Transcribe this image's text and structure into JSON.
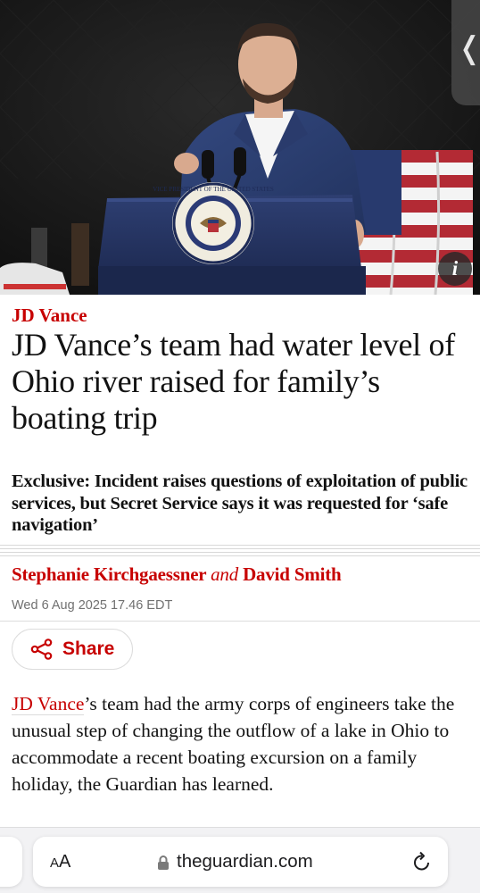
{
  "hero": {
    "seal_text": "VICE PRESIDENT OF THE UNITED STATES",
    "info_glyph": "i",
    "side_tab_glyph": "❬"
  },
  "article": {
    "kicker": "JD Vance",
    "headline": "JD Vance’s team had water level of Ohio river raised for family’s boating trip",
    "standfirst": "Exclusive: Incident raises questions of exploitation of public services, but Secret Service says it was requested for ‘safe navigation’",
    "byline": {
      "author_1": "Stephanie Kirchgaessner",
      "conjunction": "and",
      "author_2": "David Smith"
    },
    "dateline": "Wed 6 Aug 2025 17.46 EDT",
    "share_label": "Share",
    "body": {
      "lead_link": "JD Vance",
      "text": "’s team had the army corps of engineers take the unusual step of changing the outflow of a lake in Ohio to accommodate a recent boating excursion on a family holiday, the Guardian has learned."
    },
    "colors": {
      "accent_red": "#c70000",
      "text": "#121212",
      "meta_grey": "#707070"
    }
  },
  "browser": {
    "text_size_small": "A",
    "text_size_big": "A",
    "domain": "theguardian.com",
    "icons": [
      "lock-icon",
      "reload-icon",
      "share-icon",
      "info-icon",
      "chevron-left-icon"
    ]
  }
}
